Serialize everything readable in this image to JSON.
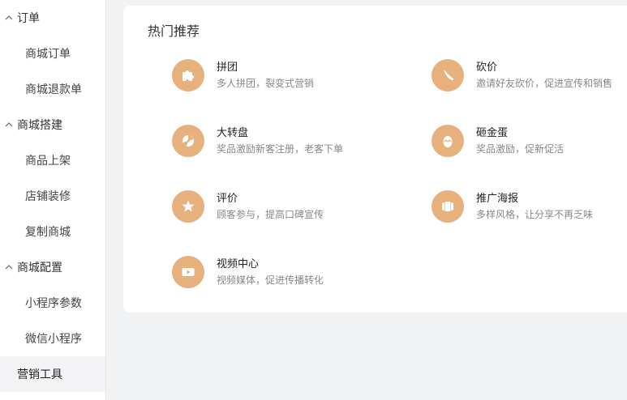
{
  "sidebar": {
    "groups": [
      {
        "label": "订单",
        "items": [
          "商城订单",
          "商城退款单"
        ]
      },
      {
        "label": "商城搭建",
        "items": [
          "商品上架",
          "店铺装修",
          "复制商城"
        ]
      },
      {
        "label": "商城配置",
        "items": [
          "小程序参数",
          "微信小程序"
        ]
      }
    ],
    "active_item": "营销工具"
  },
  "main": {
    "section_title": "热门推荐",
    "tools": [
      {
        "name": "拼团",
        "desc": "多人拼团，裂变式营销",
        "icon": "puzzle-icon"
      },
      {
        "name": "砍价",
        "desc": "邀请好友砍价，促进宣传和销售",
        "icon": "knife-icon"
      },
      {
        "name": "大转盘",
        "desc": "奖品激励新客注册，老客下单",
        "icon": "wheel-icon"
      },
      {
        "name": "砸金蛋",
        "desc": "奖品激励，促新促活",
        "icon": "egg-icon"
      },
      {
        "name": "评价",
        "desc": "顾客参与，提高口碑宣传",
        "icon": "star-icon"
      },
      {
        "name": "推广海报",
        "desc": "多样风格，让分享不再乏味",
        "icon": "poster-icon"
      },
      {
        "name": "视频中心",
        "desc": "视频媒体，促进传播转化",
        "icon": "video-icon"
      }
    ]
  },
  "colors": {
    "icon_bg": "#e6b17c",
    "page_bg": "#f1f2f4",
    "card_bg": "#ffffff"
  }
}
